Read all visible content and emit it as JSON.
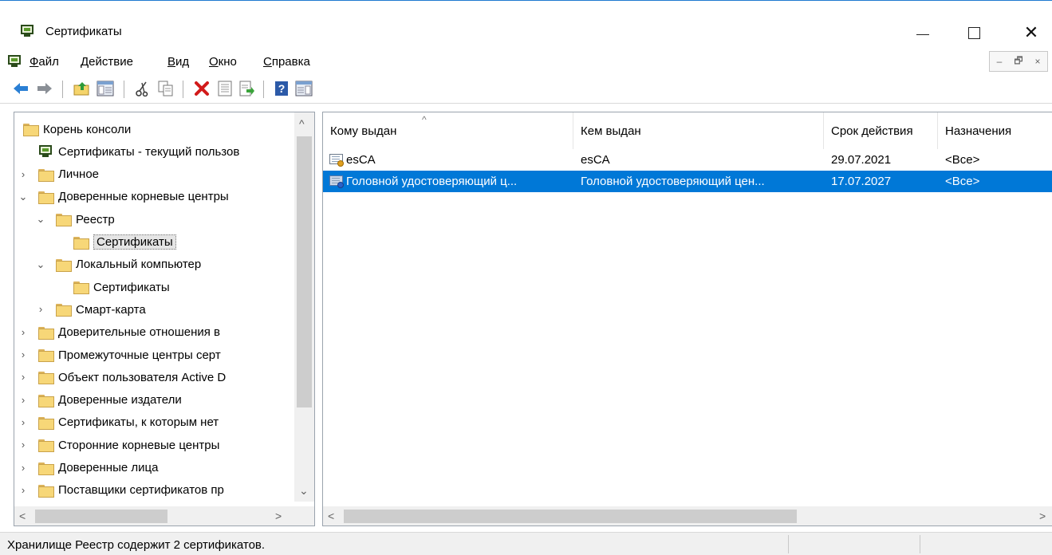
{
  "window": {
    "title": "Сертификаты",
    "minimize_icon": "minimize-icon",
    "maximize_icon": "maximize-icon",
    "close_icon": "close-icon"
  },
  "menu": {
    "items": [
      {
        "label": "Файл",
        "accel": "Ф",
        "rest": "айл"
      },
      {
        "label": "Действие",
        "accel": "Д",
        "rest": "ействие"
      },
      {
        "label": "Вид",
        "accel": "В",
        "rest": "ид"
      },
      {
        "label": "Окно",
        "accel": "О",
        "rest": "кно"
      },
      {
        "label": "Справка",
        "accel": "С",
        "rest": "правка"
      }
    ],
    "mdi_controls": [
      "–",
      "🗗",
      "×"
    ]
  },
  "toolbar": {
    "buttons": [
      "back-icon",
      "forward-icon",
      "up-folder-icon",
      "show-hide-tree-icon",
      "cut-icon",
      "copy-icon",
      "delete-icon",
      "properties-icon",
      "export-icon",
      "help-icon",
      "action-pane-icon"
    ]
  },
  "tree": {
    "items": [
      {
        "label": "Корень консоли",
        "level": 0,
        "expander": ""
      },
      {
        "label": "Сертификаты - текущий пользов",
        "level": 0,
        "expander": "expanded"
      },
      {
        "label": "Личное",
        "level": 1,
        "expander": "collapsed"
      },
      {
        "label": "Доверенные корневые центры",
        "level": 1,
        "expander": "expanded"
      },
      {
        "label": "Реестр",
        "level": 2,
        "expander": "expanded"
      },
      {
        "label": "Сертификаты",
        "level": 3,
        "expander": "",
        "selected": true
      },
      {
        "label": "Локальный компьютер",
        "level": 2,
        "expander": "expanded"
      },
      {
        "label": "Сертификаты",
        "level": 3,
        "expander": ""
      },
      {
        "label": "Смарт-карта",
        "level": 2,
        "expander": "collapsed"
      },
      {
        "label": "Доверительные отношения в",
        "level": 1,
        "expander": "collapsed"
      },
      {
        "label": "Промежуточные центры серт",
        "level": 1,
        "expander": "collapsed"
      },
      {
        "label": "Объект пользователя Active D",
        "level": 1,
        "expander": "collapsed"
      },
      {
        "label": "Доверенные издатели",
        "level": 1,
        "expander": "collapsed"
      },
      {
        "label": "Сертификаты, к которым нет",
        "level": 1,
        "expander": "collapsed"
      },
      {
        "label": "Сторонние корневые центры",
        "level": 1,
        "expander": "collapsed"
      },
      {
        "label": "Доверенные лица",
        "level": 1,
        "expander": "collapsed"
      },
      {
        "label": "Поставщики сертификатов пр",
        "level": 1,
        "expander": "collapsed"
      }
    ]
  },
  "list": {
    "columns": [
      "Кому выдан",
      "Кем выдан",
      "Срок действия",
      "Назначения"
    ],
    "rows": [
      {
        "issued_to": "esCA",
        "issued_by": "esCA",
        "expires": "29.07.2021",
        "purposes": "<Все>",
        "icon": "certificate-icon",
        "selected": false
      },
      {
        "issued_to": "Головной удостоверяющий ц...",
        "issued_by": "Головной удостоверяющий цен...",
        "expires": "17.07.2027",
        "purposes": "<Все>",
        "icon": "certificate-icon",
        "selected": true
      }
    ]
  },
  "status": {
    "text": "Хранилище Реестр содержит 2 сертификатов."
  }
}
